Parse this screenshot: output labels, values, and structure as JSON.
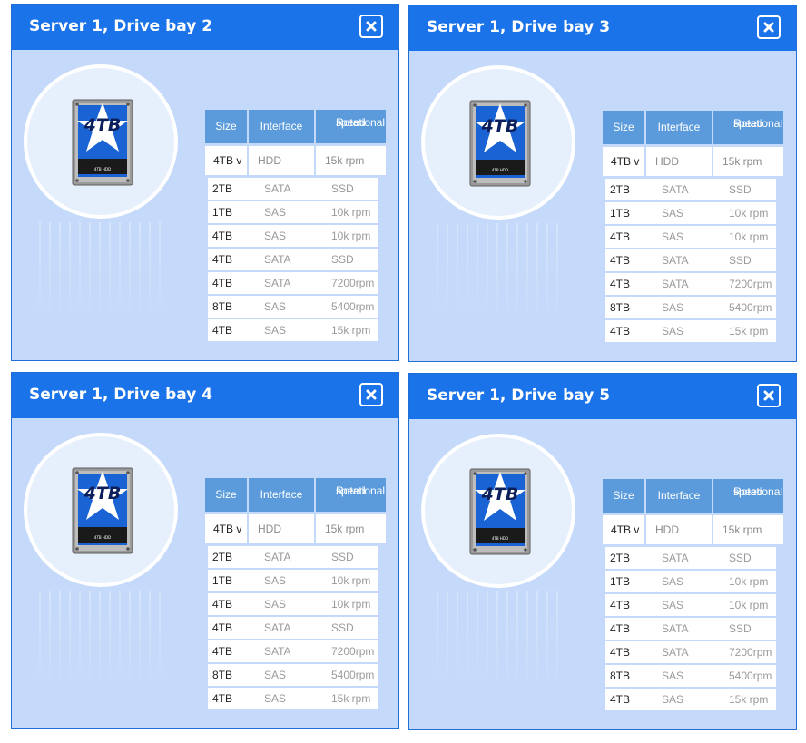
{
  "panels": [
    {
      "title": "Server 1, Drive bay 2",
      "drive_label": "4TB",
      "drive_caption": "4TB HDD",
      "headers": {
        "size": "Size",
        "interface": "Interface",
        "speed_line1": "Rotational",
        "speed_line2": "speed"
      },
      "selected": {
        "size": "4TB v",
        "interface": "HDD",
        "speed": "15k rpm"
      },
      "options": [
        {
          "size": "2TB",
          "interface": "SATA",
          "speed": "SSD"
        },
        {
          "size": "1TB",
          "interface": "SAS",
          "speed": "10k rpm"
        },
        {
          "size": "4TB",
          "interface": "SAS",
          "speed": "10k rpm"
        },
        {
          "size": "4TB",
          "interface": "SATA",
          "speed": "SSD"
        },
        {
          "size": "4TB",
          "interface": "SATA",
          "speed": "7200rpm"
        },
        {
          "size": "8TB",
          "interface": "SAS",
          "speed": "5400rpm"
        },
        {
          "size": "4TB",
          "interface": "SAS",
          "speed": "15k rpm"
        }
      ]
    },
    {
      "title": "Server 1, Drive bay 3",
      "drive_label": "4TB",
      "drive_caption": "4TB HDD",
      "headers": {
        "size": "Size",
        "interface": "Interface",
        "speed_line1": "Rotational",
        "speed_line2": "speed"
      },
      "selected": {
        "size": "4TB v",
        "interface": "HDD",
        "speed": "15k rpm"
      },
      "options": [
        {
          "size": "2TB",
          "interface": "SATA",
          "speed": "SSD"
        },
        {
          "size": "1TB",
          "interface": "SAS",
          "speed": "10k rpm"
        },
        {
          "size": "4TB",
          "interface": "SAS",
          "speed": "10k rpm"
        },
        {
          "size": "4TB",
          "interface": "SATA",
          "speed": "SSD"
        },
        {
          "size": "4TB",
          "interface": "SATA",
          "speed": "7200rpm"
        },
        {
          "size": "8TB",
          "interface": "SAS",
          "speed": "5400rpm"
        },
        {
          "size": "4TB",
          "interface": "SAS",
          "speed": "15k rpm"
        }
      ]
    },
    {
      "title": "Server 1, Drive bay 4",
      "drive_label": "4TB",
      "drive_caption": "4TB HDD",
      "headers": {
        "size": "Size",
        "interface": "Interface",
        "speed_line1": "Rotational",
        "speed_line2": "speed"
      },
      "selected": {
        "size": "4TB v",
        "interface": "HDD",
        "speed": "15k rpm"
      },
      "options": [
        {
          "size": "2TB",
          "interface": "SATA",
          "speed": "SSD"
        },
        {
          "size": "1TB",
          "interface": "SAS",
          "speed": "10k rpm"
        },
        {
          "size": "4TB",
          "interface": "SAS",
          "speed": "10k rpm"
        },
        {
          "size": "4TB",
          "interface": "SATA",
          "speed": "SSD"
        },
        {
          "size": "4TB",
          "interface": "SATA",
          "speed": "7200rpm"
        },
        {
          "size": "8TB",
          "interface": "SAS",
          "speed": "5400rpm"
        },
        {
          "size": "4TB",
          "interface": "SAS",
          "speed": "15k rpm"
        }
      ]
    },
    {
      "title": "Server 1, Drive bay 5",
      "drive_label": "4TB",
      "drive_caption": "4TB HDD",
      "headers": {
        "size": "Size",
        "interface": "Interface",
        "speed_line1": "Rotational",
        "speed_line2": "speed"
      },
      "selected": {
        "size": "4TB v",
        "interface": "HDD",
        "speed": "15k rpm"
      },
      "options": [
        {
          "size": "2TB",
          "interface": "SATA",
          "speed": "SSD"
        },
        {
          "size": "1TB",
          "interface": "SAS",
          "speed": "10k rpm"
        },
        {
          "size": "4TB",
          "interface": "SAS",
          "speed": "10k rpm"
        },
        {
          "size": "4TB",
          "interface": "SATA",
          "speed": "SSD"
        },
        {
          "size": "4TB",
          "interface": "SATA",
          "speed": "7200rpm"
        },
        {
          "size": "8TB",
          "interface": "SAS",
          "speed": "5400rpm"
        },
        {
          "size": "4TB",
          "interface": "SAS",
          "speed": "15k rpm"
        }
      ]
    }
  ],
  "icons": {
    "close": "close-icon",
    "drive": "hard-drive-icon",
    "star": "star-icon"
  },
  "colors": {
    "header_blue": "#1a73e8",
    "panel_bg": "#c5dafa",
    "table_header": "#5b9bdb"
  }
}
